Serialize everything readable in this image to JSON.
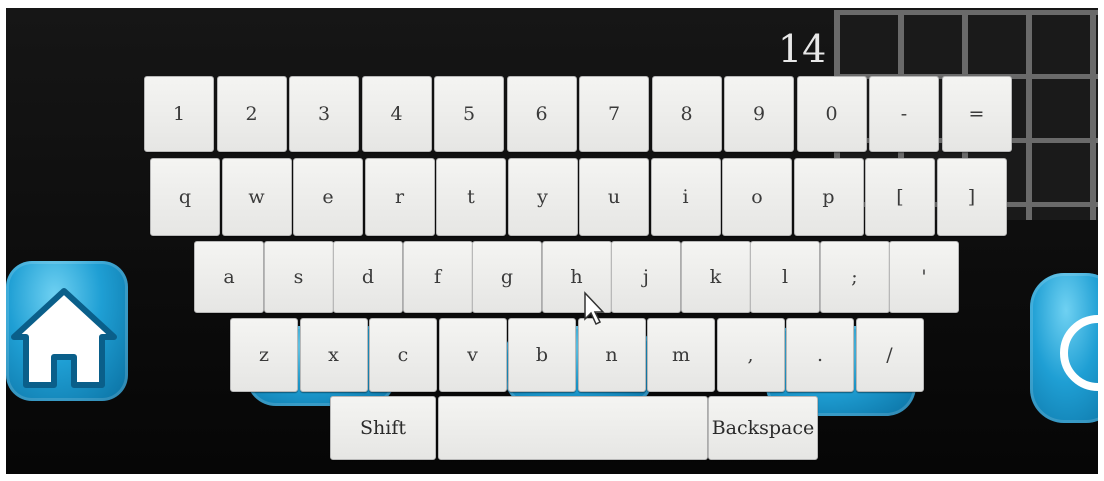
{
  "counter": "14",
  "keyboard": {
    "rows": [
      [
        "1",
        "2",
        "3",
        "4",
        "5",
        "6",
        "7",
        "8",
        "9",
        "0",
        "-",
        "="
      ],
      [
        "q",
        "w",
        "e",
        "r",
        "t",
        "y",
        "u",
        "i",
        "o",
        "p",
        "[",
        "]"
      ],
      [
        "a",
        "s",
        "d",
        "f",
        "g",
        "h",
        "j",
        "k",
        "l",
        ";",
        "'"
      ],
      [
        "z",
        "x",
        "c",
        "v",
        "b",
        "n",
        "m",
        ",",
        ".",
        "/"
      ]
    ],
    "shift_label": "Shift",
    "space_label": "",
    "backspace_label": "Backspace"
  },
  "icons": {
    "home": "home-icon",
    "power": "power-icon",
    "cursor": "mouse-cursor-icon"
  },
  "colors": {
    "key_face": "#eeeeec",
    "key_text": "#3a3a3a",
    "button_blue": "#1f9fd4",
    "background": "#111111"
  }
}
